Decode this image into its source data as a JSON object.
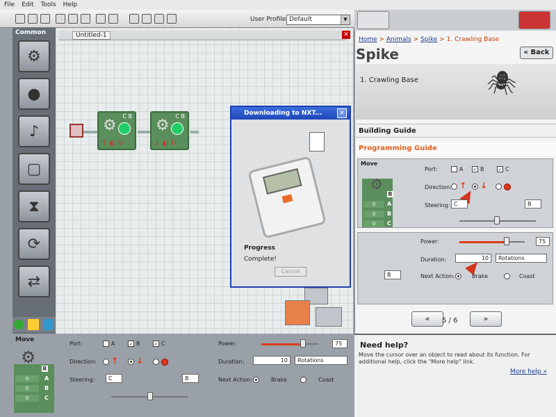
{
  "menu": [
    "File",
    "Edit",
    "Tools",
    "Help"
  ],
  "toolbar": {
    "profile_label": "User Profile:",
    "profile_value": "Default"
  },
  "palette": {
    "title": "Common"
  },
  "canvas": {
    "tab_label": "Untitled-1",
    "block1_ports": "C B",
    "block2_ports": "C B"
  },
  "dialog": {
    "title": "Downloading to NXT...",
    "progress_label": "Progress",
    "status": "Complete!",
    "cancel_label": "Cancel"
  },
  "guide": {
    "breadcrumb": [
      "Home",
      "Animals",
      "Spike",
      "1. Crawling Base"
    ],
    "breadcrumb_sep": " > ",
    "title": "Spike",
    "back_label": "« Back",
    "step_title": "1. Crawling Base",
    "building_guide": "Building Guide",
    "programming_guide": "Programming Guide",
    "pager": "5 / 6",
    "prev_label": "«",
    "next_label": "»"
  },
  "move_config": {
    "title": "Move",
    "port_label": "Port:",
    "port_a": "A",
    "port_b": "B",
    "port_c": "C",
    "direction_label": "Direction:",
    "steering_label": "Steering:",
    "steering_left": "C",
    "steering_right": "B",
    "power_label": "Power:",
    "power_value": "75",
    "duration_label": "Duration:",
    "duration_value": "10",
    "duration_unit": "Rotations",
    "next_action_label": "Next Action:",
    "brake_label": "Brake",
    "coast_label": "Coast",
    "port_cells": [
      "0",
      "0",
      "0"
    ],
    "port_letters": [
      "A",
      "B",
      "C"
    ],
    "r_label": "R"
  },
  "help": {
    "title": "Need help?",
    "text": "Move the cursor over an object to read about its function. For additional help, click the \"More help\" link.",
    "link": "More help »"
  },
  "colors": {
    "accent": "#e03a1a",
    "block": "#5a8e5c",
    "titlebar": "#1f47b8"
  }
}
